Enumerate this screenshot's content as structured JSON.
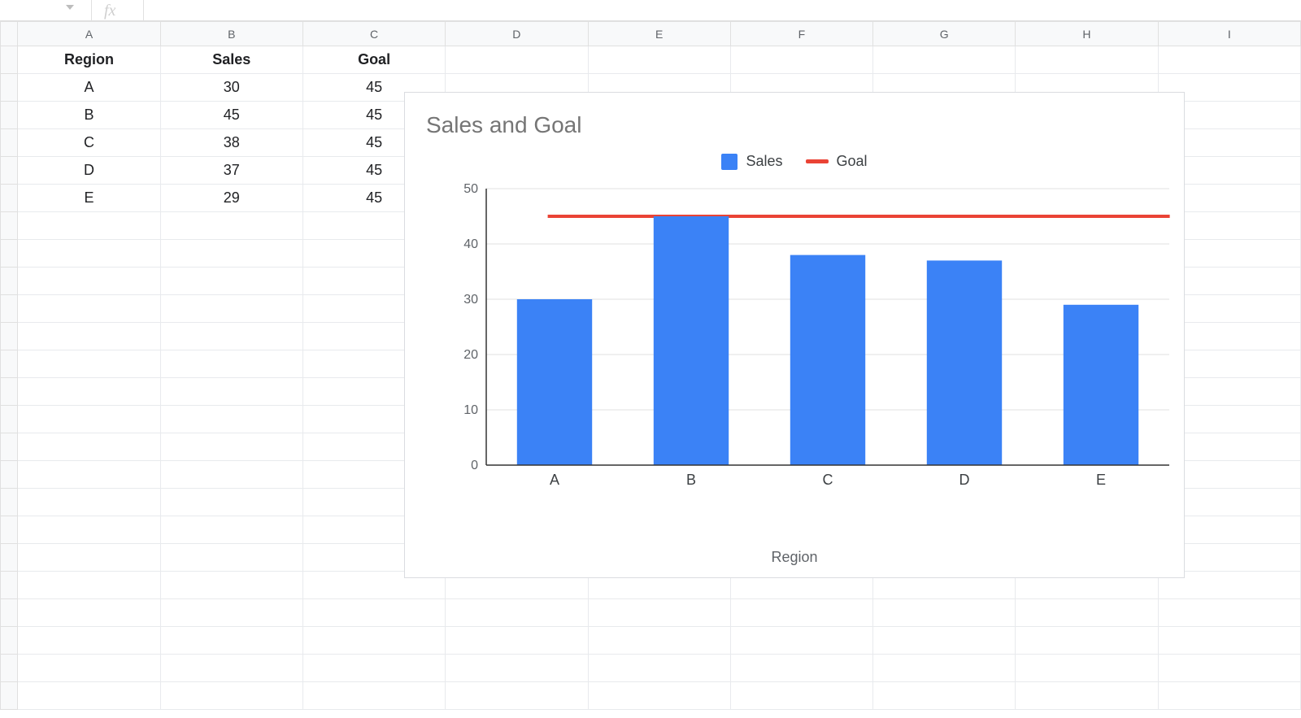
{
  "formula_bar": {
    "fx": "fx"
  },
  "columns": [
    "A",
    "B",
    "C",
    "D",
    "E",
    "F",
    "G",
    "H",
    "I"
  ],
  "table": {
    "headers": {
      "region": "Region",
      "sales": "Sales",
      "goal": "Goal"
    },
    "rows": [
      {
        "region": "A",
        "sales": "30",
        "goal": "45"
      },
      {
        "region": "B",
        "sales": "45",
        "goal": "45"
      },
      {
        "region": "C",
        "sales": "38",
        "goal": "45"
      },
      {
        "region": "D",
        "sales": "37",
        "goal": "45"
      },
      {
        "region": "E",
        "sales": "29",
        "goal": "45"
      }
    ]
  },
  "chart": {
    "title": "Sales and Goal",
    "legend": {
      "sales": "Sales",
      "goal": "Goal"
    },
    "xlabel": "Region"
  },
  "chart_data": {
    "type": "bar",
    "title": "Sales and Goal",
    "xlabel": "Region",
    "ylabel": "",
    "categories": [
      "A",
      "B",
      "C",
      "D",
      "E"
    ],
    "series": [
      {
        "name": "Sales",
        "type": "bar",
        "values": [
          30,
          45,
          38,
          37,
          29
        ],
        "color": "#3b82f6"
      },
      {
        "name": "Goal",
        "type": "line",
        "values": [
          45,
          45,
          45,
          45,
          45
        ],
        "color": "#ea4335"
      }
    ],
    "ylim": [
      0,
      50
    ],
    "yticks": [
      0,
      10,
      20,
      30,
      40,
      50
    ],
    "grid": true,
    "legend_position": "top"
  }
}
